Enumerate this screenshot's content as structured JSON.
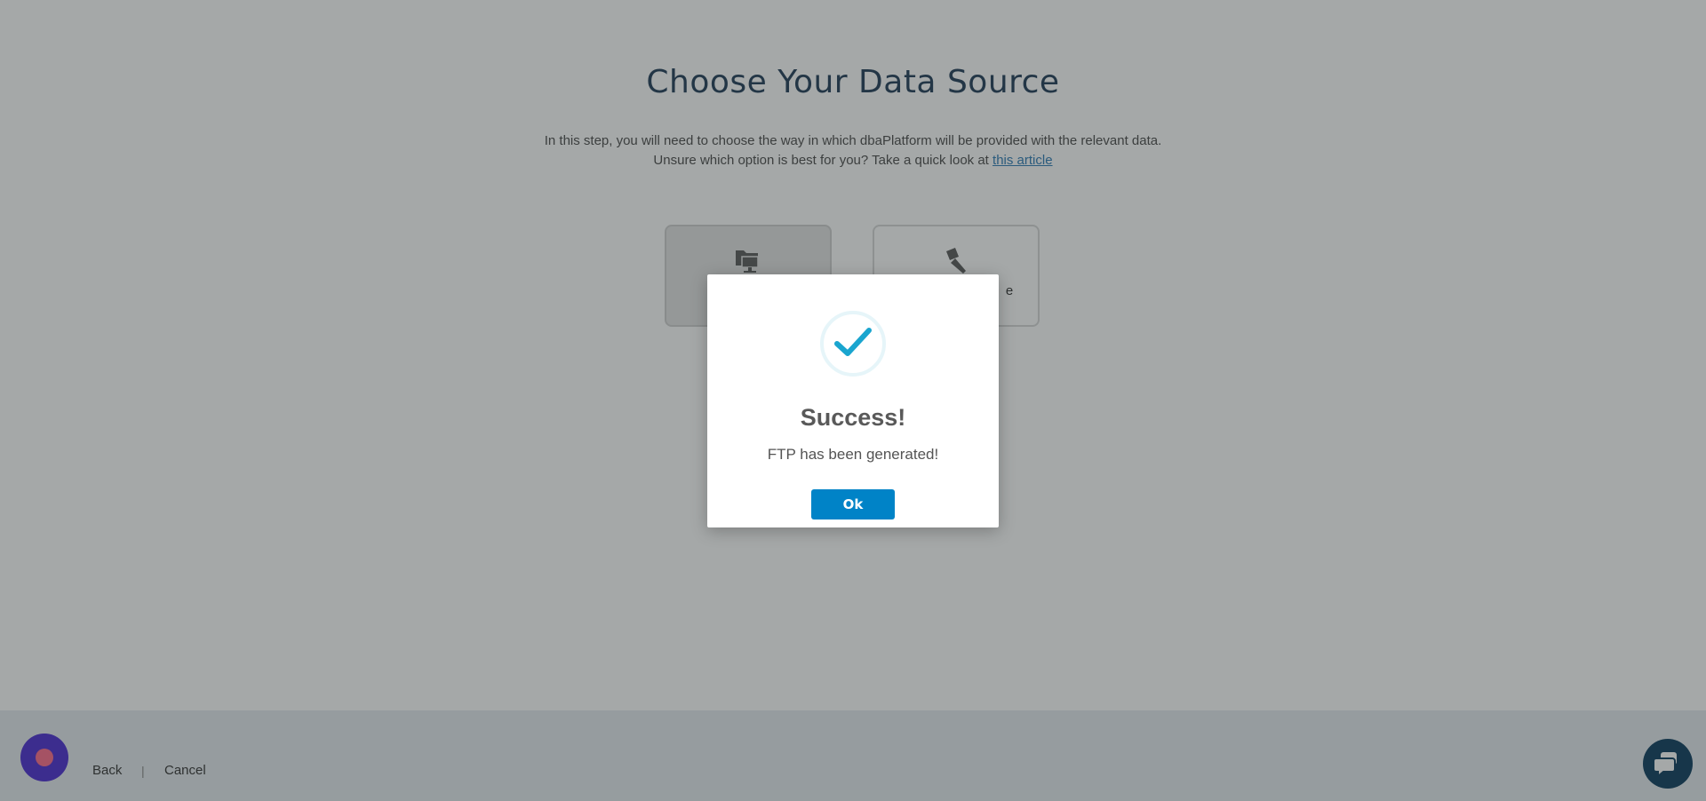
{
  "page": {
    "title": "Choose Your Data Source",
    "intro_line1": "In this step, you will need to choose the way in which dbaPlatform will be provided with the relevant data.",
    "intro_line2_prefix": "Unsure which option is best for you? Take a quick look at ",
    "intro_link": "this article"
  },
  "options": [
    {
      "id": "ftp",
      "icon": "folder-computer-icon",
      "label": "",
      "selected": true
    },
    {
      "id": "other",
      "icon": "brush-icon",
      "label": "e",
      "selected": false
    }
  ],
  "footer": {
    "back": "Back",
    "separator": "|",
    "cancel": "Cancel"
  },
  "modal": {
    "icon": "check-icon",
    "title": "Success!",
    "message": "FTP has been generated!",
    "ok_label": "Ok"
  },
  "colors": {
    "accent": "#0083c7",
    "check": "#1aa5cf",
    "title": "#1f3b57",
    "chat_left": "#4b2bd3",
    "chat_right": "#0b3c5d"
  }
}
